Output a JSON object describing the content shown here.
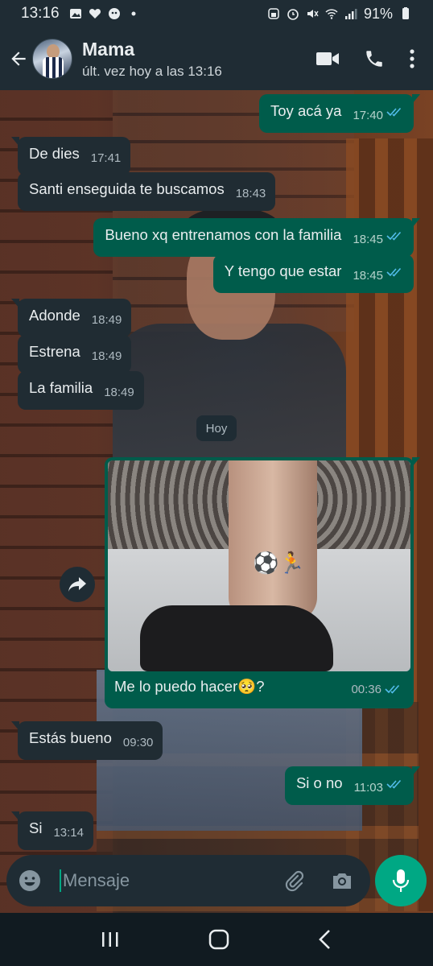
{
  "status_bar": {
    "time": "13:16",
    "battery": "91%"
  },
  "header": {
    "contact_name": "Mama",
    "last_seen": "últ. vez hoy a las 13:16"
  },
  "messages": [
    {
      "dir": "out",
      "text": "Toy acá ya",
      "time": "17:40"
    },
    {
      "dir": "in",
      "text": "De dies",
      "time": "17:41"
    },
    {
      "dir": "in",
      "text": "Santi enseguida te buscamos",
      "time": "18:43"
    },
    {
      "dir": "out",
      "text": "Bueno xq entrenamos con la familia",
      "time": "18:45"
    },
    {
      "dir": "out",
      "text": "Y tengo que estar",
      "time": "18:45"
    },
    {
      "dir": "in",
      "text": "Adonde",
      "time": "18:49"
    },
    {
      "dir": "in",
      "text": "Estrena",
      "time": "18:49"
    },
    {
      "dir": "in",
      "text": "La familia",
      "time": "18:49"
    },
    {
      "dir": "out",
      "text": "Me lo puedo hacer🥺?",
      "time": "00:36",
      "has_image": true
    },
    {
      "dir": "in",
      "text": "Estás bueno",
      "time": "09:30"
    },
    {
      "dir": "out",
      "text": "Si o no",
      "time": "11:03"
    },
    {
      "dir": "in",
      "text": "Si",
      "time": "13:14"
    }
  ],
  "date_chip": "Hoy",
  "input": {
    "placeholder": "Mensaje"
  },
  "colors": {
    "incoming": "#202c33",
    "outgoing": "#005c4b",
    "accent": "#00a884",
    "read_tick": "#53bdeb"
  },
  "icons": [
    "back-arrow-icon",
    "video-call-icon",
    "phone-icon",
    "more-options-icon",
    "forward-icon",
    "emoji-icon",
    "attach-icon",
    "camera-icon",
    "mic-icon",
    "recents-icon",
    "home-icon",
    "nav-back-icon"
  ]
}
